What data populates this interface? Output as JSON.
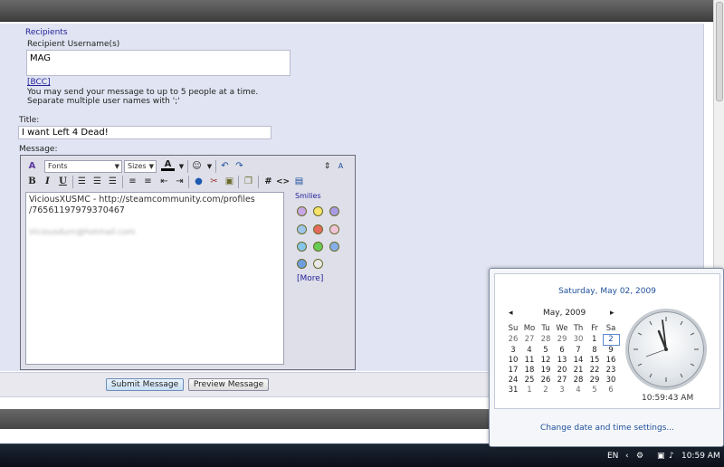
{
  "form": {
    "section_title": "Recipients",
    "recipient_label": "Recipient Username(s)",
    "recipient_value": "MAG",
    "bcc_link": "[BCC]",
    "info_line1": "You may send your message to up to 5 people at a time.",
    "info_line2": "Separate multiple user names with ';'",
    "title_label": "Title:",
    "title_value": "I want Left 4 Dead!",
    "message_label": "Message:"
  },
  "editor": {
    "font_select": "Fonts",
    "size_select": "Sizes",
    "bold": "B",
    "italic": "I",
    "underline": "U",
    "hash_button": "#",
    "code_button": "<>",
    "message_line1": "ViciousXUSMC - http://steamcommunity.com/profiles",
    "message_line2": "/76561197979370467",
    "message_line3": "Viciousdurn@hotmail.com",
    "smilies_title": "Smilies",
    "more_link": "[More]"
  },
  "buttons": {
    "submit": "Submit Message",
    "preview": "Preview Message"
  },
  "calendar_popup": {
    "long_date": "Saturday, May 02, 2009",
    "month_year": "May, 2009",
    "days_of_week": [
      "Su",
      "Mo",
      "Tu",
      "We",
      "Th",
      "Fr",
      "Sa"
    ],
    "weeks": [
      [
        "26",
        "27",
        "28",
        "29",
        "30",
        "1",
        "2"
      ],
      [
        "3",
        "4",
        "5",
        "6",
        "7",
        "8",
        "9"
      ],
      [
        "10",
        "11",
        "12",
        "13",
        "14",
        "15",
        "16"
      ],
      [
        "17",
        "18",
        "19",
        "20",
        "21",
        "22",
        "23"
      ],
      [
        "24",
        "25",
        "26",
        "27",
        "28",
        "29",
        "30"
      ],
      [
        "31",
        "1",
        "2",
        "3",
        "4",
        "5",
        "6"
      ]
    ],
    "clock_time": "10:59:43 AM",
    "change_link": "Change date and time settings..."
  },
  "taskbar": {
    "language": "EN",
    "clock": "10:59 AM"
  },
  "colors": {
    "form_background": "#e1e4f2",
    "link_blue": "#22229a",
    "taskbar": "#0a0f18"
  }
}
